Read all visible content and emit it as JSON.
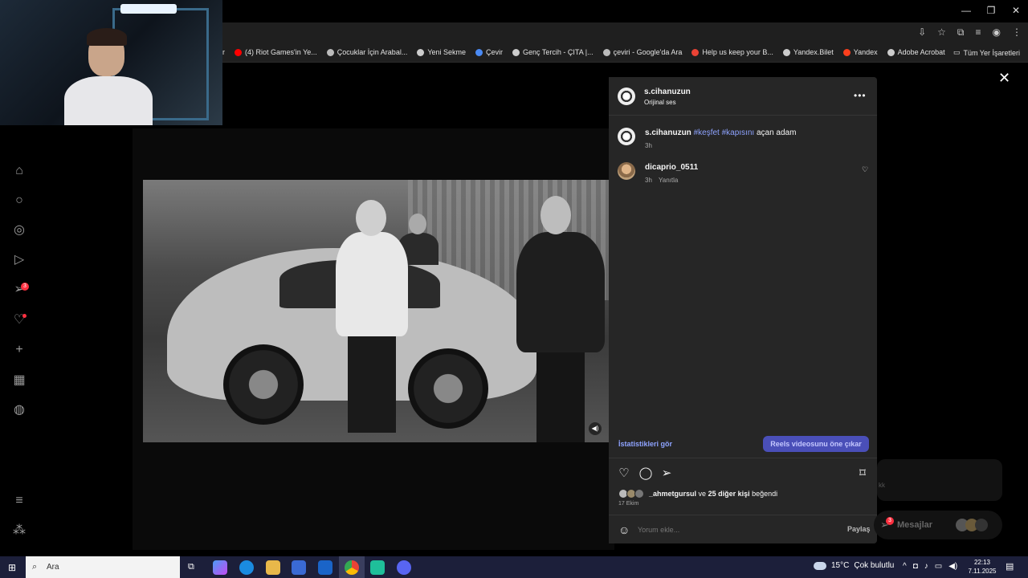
{
  "browser": {
    "minimize": "—",
    "restore": "❐",
    "close": "✕",
    "bookmarks": [
      {
        "label": "ar",
        "icon": "none"
      },
      {
        "label": "(4) Riot Games'in Ye...",
        "icon": "youtube-icon",
        "color": "#ff0000"
      },
      {
        "label": "Çocuklar İçin Arabal...",
        "icon": "google-icon",
        "color": "#bbbbbb"
      },
      {
        "label": "Yeni Sekme",
        "icon": "chrome-icon",
        "color": "#cccccc"
      },
      {
        "label": "Çevir",
        "icon": "translate-icon",
        "color": "#4a8af4"
      },
      {
        "label": "Genç Tercih - ÇITA |...",
        "icon": "globe-icon",
        "color": "#cccccc"
      },
      {
        "label": "çeviri - Google'da Ara",
        "icon": "google-icon",
        "color": "#bbbbbb"
      },
      {
        "label": "Help us keep your B...",
        "icon": "gmail-icon",
        "color": "#ea4335"
      },
      {
        "label": "Yandex.Bilet",
        "icon": "globe-icon",
        "color": "#cccccc"
      },
      {
        "label": "Yandex",
        "icon": "yandex-icon",
        "color": "#fc3f1d"
      },
      {
        "label": "Adobe Acrobat",
        "icon": "globe-icon",
        "color": "#cccccc"
      }
    ],
    "all_bookmarks": "Tüm Yer İşaretleri"
  },
  "post": {
    "author": "s.cihanuzun",
    "audio": "Orijinal ses",
    "caption_user": "s.cihanuzun",
    "caption_tags": "#keşfet #kapısını",
    "caption_text": "açan adam",
    "caption_time": "3h",
    "comment_user": "dicaprio_0511",
    "comment_time": "3h",
    "comment_reply": "Yanıtla",
    "stats_link": "İstatistikleri gör",
    "boost_button": "Reels videosunu öne çıkar",
    "likes_user": "_ahmetgursul",
    "likes_connector": "ve",
    "likes_others": "25 diğer kişi",
    "likes_suffix": "beğendi",
    "date": "17 Ekim",
    "comment_placeholder": "Yorum ekle...",
    "share": "Paylaş"
  },
  "sidebar": {
    "notifications_badge": "3",
    "accent": "#ff3040"
  },
  "background": {
    "messages_label": "Mesajlar",
    "messages_badge": "3",
    "faded_text": "kk"
  },
  "taskbar": {
    "search_label": "Ara",
    "weather_temp": "15°C",
    "weather_desc": "Çok bulutlu",
    "time": "22:13",
    "date": "7.11.2025"
  }
}
